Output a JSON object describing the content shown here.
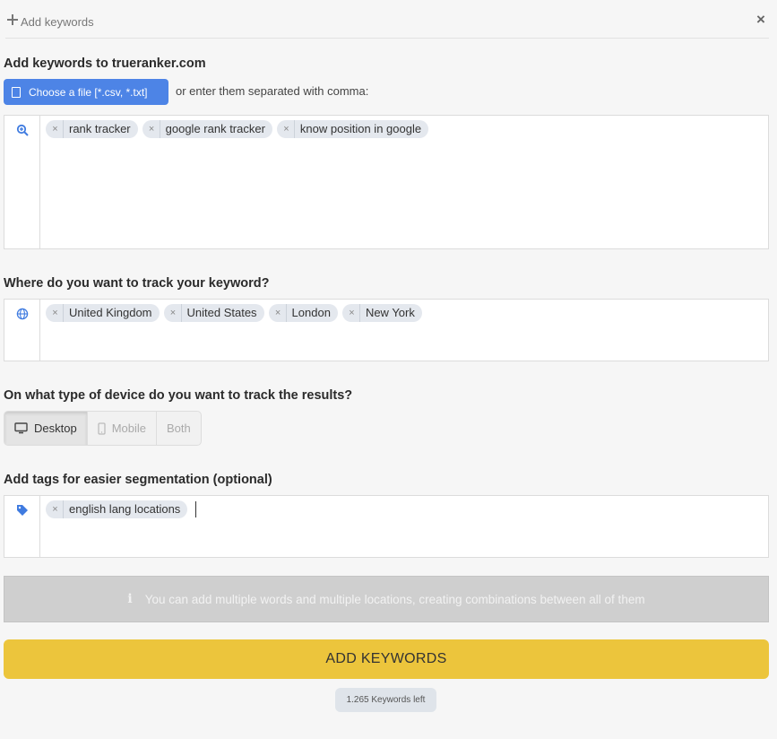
{
  "header": {
    "title": "Add keywords",
    "close": "×"
  },
  "keywords_section": {
    "heading": "Add keywords to trueranker.com",
    "file_button": "Choose a file [*.csv, *.txt]",
    "or_text": "or enter them separated with comma:",
    "icon": "search-plus-icon",
    "chips": [
      "rank tracker",
      "google rank tracker",
      "know position in google"
    ]
  },
  "locations_section": {
    "heading": "Where do you want to track your keyword?",
    "icon": "globe-icon",
    "chips": [
      "United Kingdom",
      "United States",
      "London",
      "New York"
    ]
  },
  "device_section": {
    "heading": "On what type of device do you want to track the results?",
    "options": [
      {
        "label": "Desktop",
        "icon": "desktop-icon",
        "active": true
      },
      {
        "label": "Mobile",
        "icon": "mobile-icon",
        "active": false
      },
      {
        "label": "Both",
        "icon": "",
        "active": false
      }
    ]
  },
  "tags_section": {
    "heading": "Add tags for easier segmentation (optional)",
    "icon": "tag-icon",
    "chips": [
      "english lang locations"
    ]
  },
  "info_text": "You can add multiple words and multiple locations, creating combinations between all of them",
  "submit_label": "ADD KEYWORDS",
  "keywords_left": "1.265 Keywords left",
  "colors": {
    "primary": "#4d84e6",
    "submit": "#ecc53c",
    "chip": "#e4e8ee",
    "icon_blue": "#3f7be0"
  }
}
